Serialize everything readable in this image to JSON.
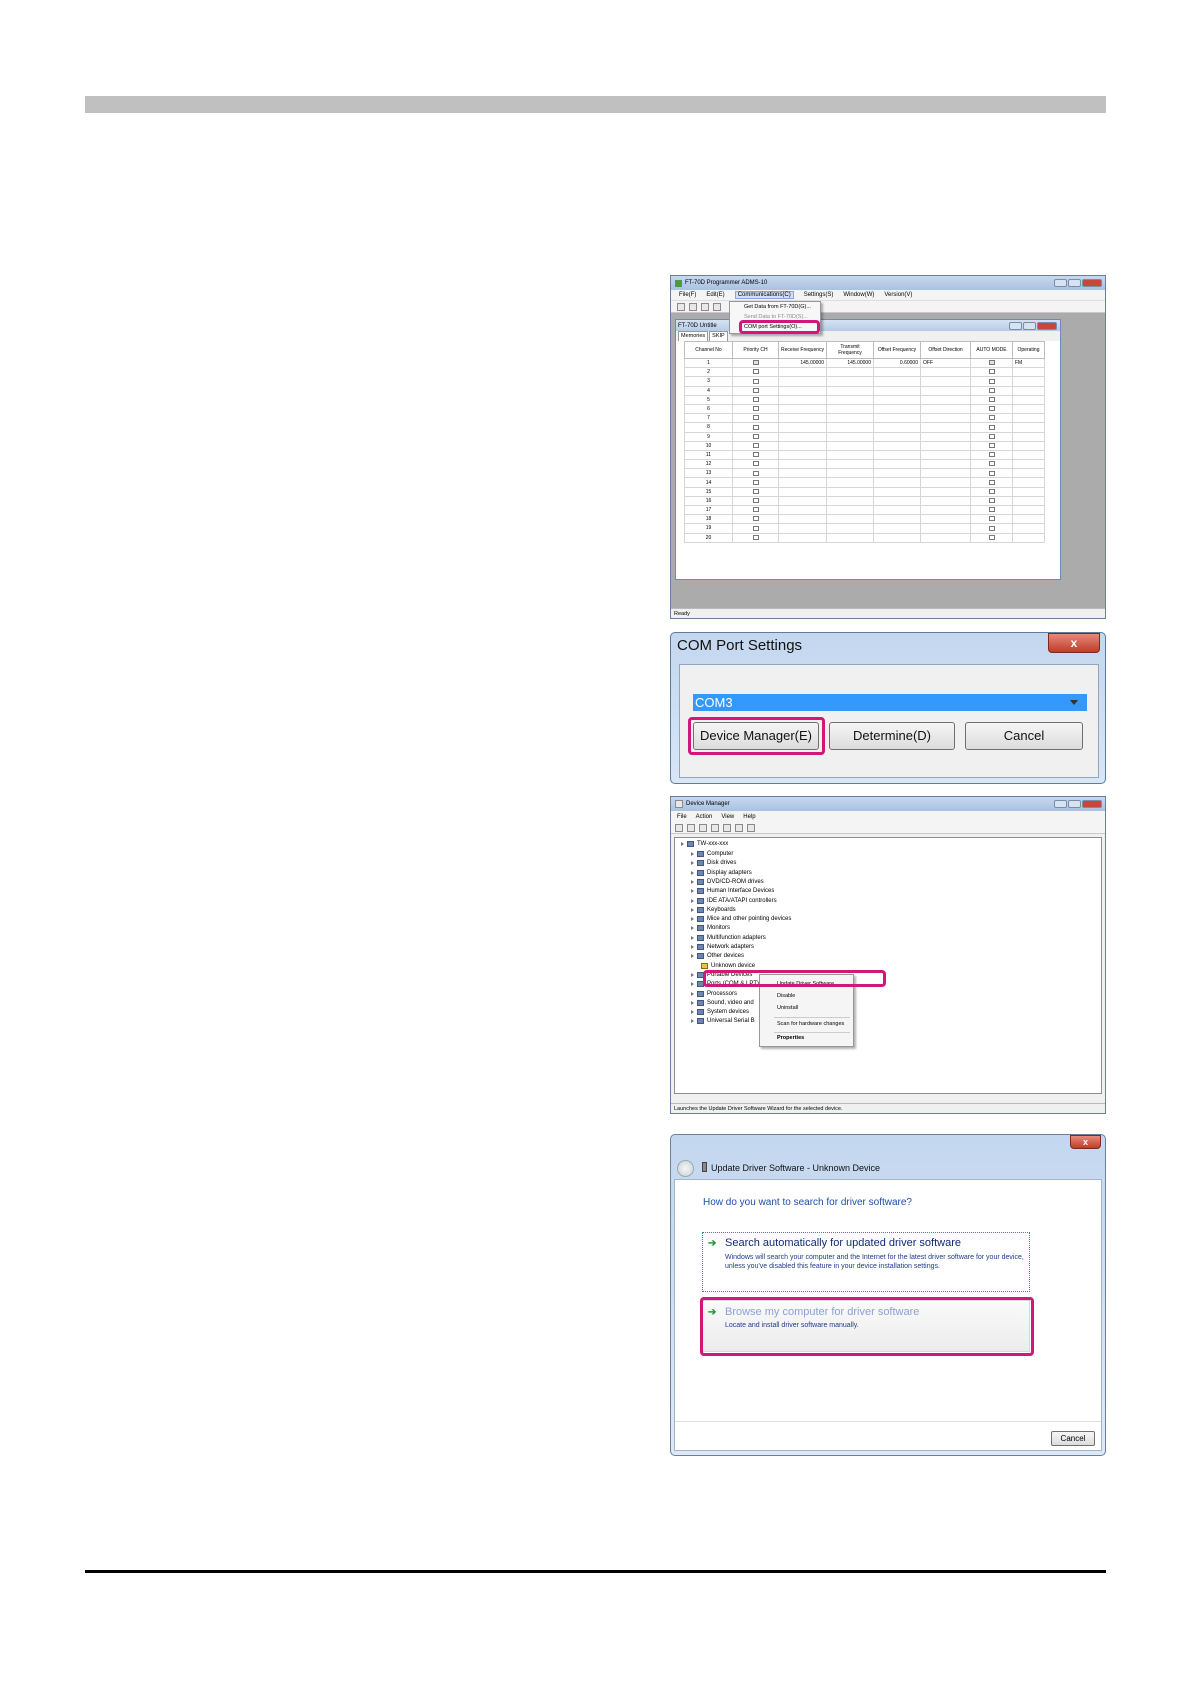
{
  "adms": {
    "title": "FT-70D Programmer ADMS-10",
    "menus": [
      "File(F)",
      "Edit(E)",
      "Communications(C)",
      "Settings(S)",
      "Window(W)",
      "Version(V)"
    ],
    "dropdown": {
      "get": "Get Data from FT-70D(G)...",
      "send": "Send Data to FT-70D(S)...",
      "com": "COM port Settings(O)..."
    },
    "child_title": "FT-70D Untitle",
    "tabs": [
      "Memories",
      "SKIP"
    ],
    "columns": [
      "Channel No",
      "Priority CH",
      "Receive Frequency",
      "Transmit Frequency",
      "Offset Frequency",
      "Offset Direction",
      "AUTO MODE",
      "Operating"
    ],
    "row1": {
      "rx": "145.00000",
      "tx": "145.00000",
      "offset": "0.60000",
      "dir": "OFF",
      "mode": "FM"
    },
    "channels": [
      "1",
      "2",
      "3",
      "4",
      "5",
      "6",
      "7",
      "8",
      "9",
      "10",
      "11",
      "12",
      "13",
      "14",
      "15",
      "16",
      "17",
      "18",
      "19",
      "20"
    ],
    "status": "Ready"
  },
  "com": {
    "title": "COM Port Settings",
    "close": "x",
    "port": "COM3",
    "device_manager": "Device Manager(E)",
    "determine": "Determine(D)",
    "cancel": "Cancel"
  },
  "devmgr": {
    "title": "Device Manager",
    "menus": [
      "File",
      "Action",
      "View",
      "Help"
    ],
    "root": "TW-xxx-xxx",
    "items": [
      "Computer",
      "Disk drives",
      "Display adapters",
      "DVD/CD-ROM drives",
      "Human Interface Devices",
      "IDE ATA/ATAPI controllers",
      "Keyboards",
      "Mice and other pointing devices",
      "Monitors",
      "Multifunction adapters",
      "Network adapters",
      "Other devices",
      "Unknown device",
      "Portable Devices",
      "Ports (COM & LPT)",
      "Processors",
      "Sound, video and",
      "System devices",
      "Universal Serial B"
    ],
    "context": [
      "Update Driver Software...",
      "Disable",
      "Uninstall",
      "Scan for hardware changes",
      "Properties"
    ],
    "status": "Launches the Update Driver Software Wizard for the selected device."
  },
  "update": {
    "close": "x",
    "title": "Update Driver Software - Unknown Device",
    "question": "How do you want to search for driver software?",
    "opt1_title": "Search automatically for updated driver software",
    "opt1_desc": "Windows will search your computer and the Internet for the latest driver software for your device, unless you've disabled this feature in your device installation settings.",
    "opt2_title": "Browse my computer for driver software",
    "opt2_desc": "Locate and install driver software manually.",
    "cancel": "Cancel"
  },
  "colors": {
    "highlight": "#d4157a",
    "selection": "#3399ff"
  }
}
